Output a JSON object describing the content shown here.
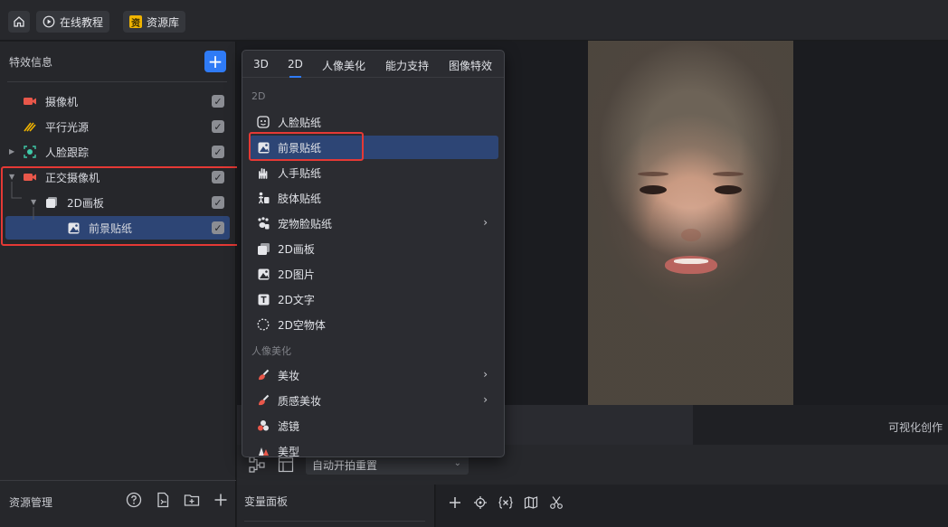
{
  "topbar": {
    "home_icon": "home-icon",
    "tutorial_label": "在线教程",
    "library_label": "资源库",
    "library_badge": "资"
  },
  "left_panel": {
    "header": "特效信息",
    "add_label": "+",
    "tree": [
      {
        "label": "摄像机",
        "icon": "camera-icon",
        "checked": true
      },
      {
        "label": "平行光源",
        "icon": "light-icon",
        "checked": true
      },
      {
        "label": "人脸跟踪",
        "icon": "face-track-icon",
        "checked": true
      },
      {
        "label": "正交摄像机",
        "icon": "camera-icon",
        "checked": true
      },
      {
        "label": "2D画板",
        "icon": "canvas-icon",
        "checked": true
      },
      {
        "label": "前景贴纸",
        "icon": "foreground-sticker-icon",
        "checked": true,
        "selected": true
      }
    ],
    "check_mark": "✓",
    "bottom_title": "资源管理"
  },
  "menu": {
    "tabs": [
      "3D",
      "2D",
      "人像美化",
      "能力支持",
      "图像特效"
    ],
    "active_tab": "2D",
    "section_2d": "2D",
    "section_beauty": "人像美化",
    "items": [
      {
        "label": "人脸贴纸",
        "icon": "face-sticker-icon",
        "arrow": ""
      },
      {
        "label": "前景贴纸",
        "icon": "foreground-sticker-icon",
        "arrow": "",
        "highlighted": true
      },
      {
        "label": "人手贴纸",
        "icon": "hand-sticker-icon",
        "arrow": ""
      },
      {
        "label": "肢体贴纸",
        "icon": "body-sticker-icon",
        "arrow": ""
      },
      {
        "label": "宠物脸贴纸",
        "icon": "pet-face-sticker-icon",
        "arrow": "›"
      },
      {
        "label": "2D画板",
        "icon": "canvas-icon",
        "arrow": ""
      },
      {
        "label": "2D图片",
        "icon": "image-icon",
        "arrow": ""
      },
      {
        "label": "2D文字",
        "icon": "text-icon",
        "arrow": ""
      },
      {
        "label": "2D空物体",
        "icon": "empty-object-icon",
        "arrow": ""
      }
    ],
    "beauty_items": [
      {
        "label": "美妆",
        "icon": "makeup-icon",
        "arrow": "›"
      },
      {
        "label": "质感美妆",
        "icon": "texture-makeup-icon",
        "arrow": "›"
      },
      {
        "label": "滤镜",
        "icon": "filter-icon",
        "arrow": ""
      },
      {
        "label": "美型",
        "icon": "reshape-icon",
        "arrow": ""
      }
    ]
  },
  "node_toolbar": {
    "select_value": "自动开拍重置",
    "caret": "⌄"
  },
  "status": {
    "right_text": "可视化创作"
  },
  "variable_panel": {
    "title": "变量面板"
  },
  "colors": {
    "accent": "#2f7bf6",
    "highlight": "#2d4575",
    "annotation": "#e53935"
  }
}
